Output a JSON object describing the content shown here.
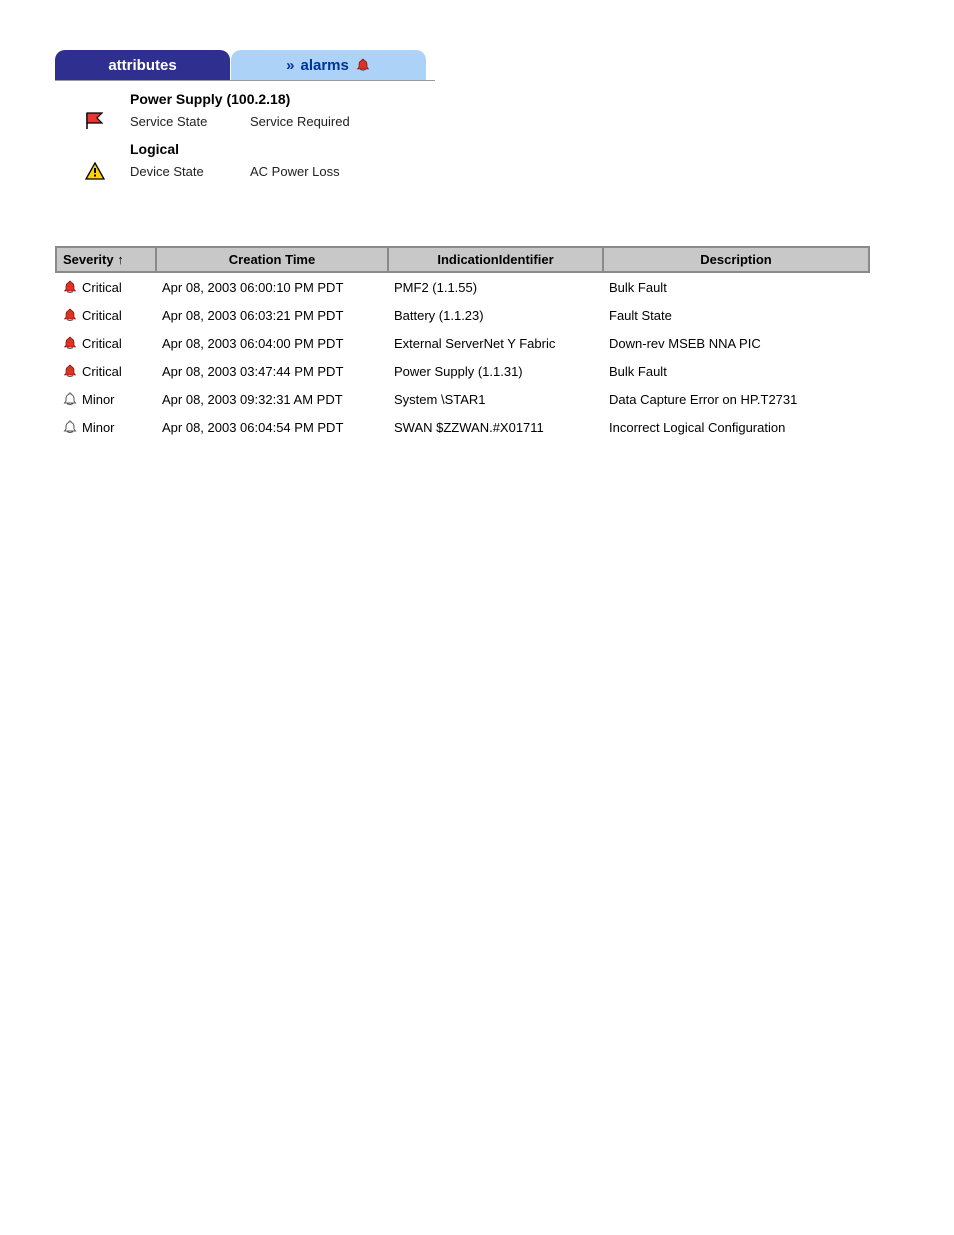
{
  "tabs": {
    "attributes": "attributes",
    "alarms_prefix": "»",
    "alarms": "alarms"
  },
  "detail": {
    "heading1": "Power Supply (100.2.18)",
    "row1_label": "Service State",
    "row1_value": "Service Required",
    "heading2": "Logical",
    "row2_label": "Device State",
    "row2_value": "AC Power Loss"
  },
  "table": {
    "headers": {
      "severity": "Severity",
      "creation_time": "Creation Time",
      "indication_identifier": "IndicationIdentifier",
      "description": "Description"
    },
    "sort_arrow": "↑",
    "rows": [
      {
        "severity": "Critical",
        "severity_level": "critical",
        "creation_time": "Apr 08, 2003 06:00:10 PM PDT",
        "identifier": "PMF2 (1.1.55)",
        "description": "Bulk Fault"
      },
      {
        "severity": "Critical",
        "severity_level": "critical",
        "creation_time": "Apr 08, 2003 06:03:21 PM PDT",
        "identifier": "Battery (1.1.23)",
        "description": "Fault State"
      },
      {
        "severity": "Critical",
        "severity_level": "critical",
        "creation_time": "Apr 08, 2003 06:04:00 PM PDT",
        "identifier": "External ServerNet Y Fabric",
        "description": "Down-rev MSEB NNA PIC"
      },
      {
        "severity": "Critical",
        "severity_level": "critical",
        "creation_time": "Apr 08, 2003 03:47:44 PM PDT",
        "identifier": "Power Supply (1.1.31)",
        "description": "Bulk Fault"
      },
      {
        "severity": "Minor",
        "severity_level": "minor",
        "creation_time": "Apr 08, 2003 09:32:31 AM PDT",
        "identifier": "System \\STAR1",
        "description": "Data Capture Error on HP.T2731"
      },
      {
        "severity": "Minor",
        "severity_level": "minor",
        "creation_time": "Apr 08, 2003 06:04:54 PM PDT",
        "identifier": "SWAN $ZZWAN.#X01711",
        "description": "Incorrect Logical Configuration"
      }
    ]
  }
}
